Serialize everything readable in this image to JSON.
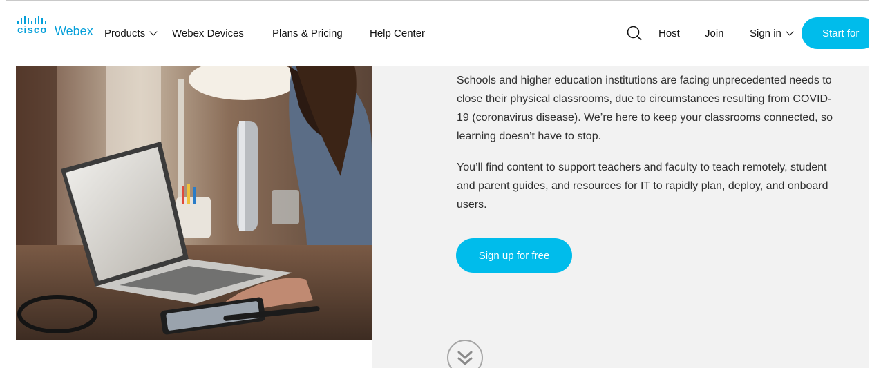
{
  "header": {
    "logo": {
      "brand": "cisco",
      "product": "Webex"
    },
    "nav": [
      {
        "label": "Products",
        "has_dropdown": true
      },
      {
        "label": "Webex Devices",
        "has_dropdown": false
      },
      {
        "label": "Plans & Pricing",
        "has_dropdown": false
      },
      {
        "label": "Help Center",
        "has_dropdown": false
      }
    ],
    "search_icon": "search-icon",
    "host_label": "Host",
    "join_label": "Join",
    "signin_label": "Sign in",
    "start_label": "Start for"
  },
  "main": {
    "paragraphs": [
      "Schools and higher education institutions are facing unprecedented needs to close their physical classrooms, due to circumstances resulting from COVID-19 (coronavirus disease). We’re here to keep your classrooms connected, so learning doesn’t have to stop.",
      "You’ll find content to support teachers and faculty to teach remotely, student and parent guides, and resources for IT to rapidly plan, deploy, and onboard users."
    ],
    "signup_label": "Sign up for free",
    "scroll_icon": "double-chevron-down-icon"
  },
  "colors": {
    "accent": "#00bceb",
    "logo": "#049fd9",
    "panel_bg": "#f2f2f2"
  }
}
